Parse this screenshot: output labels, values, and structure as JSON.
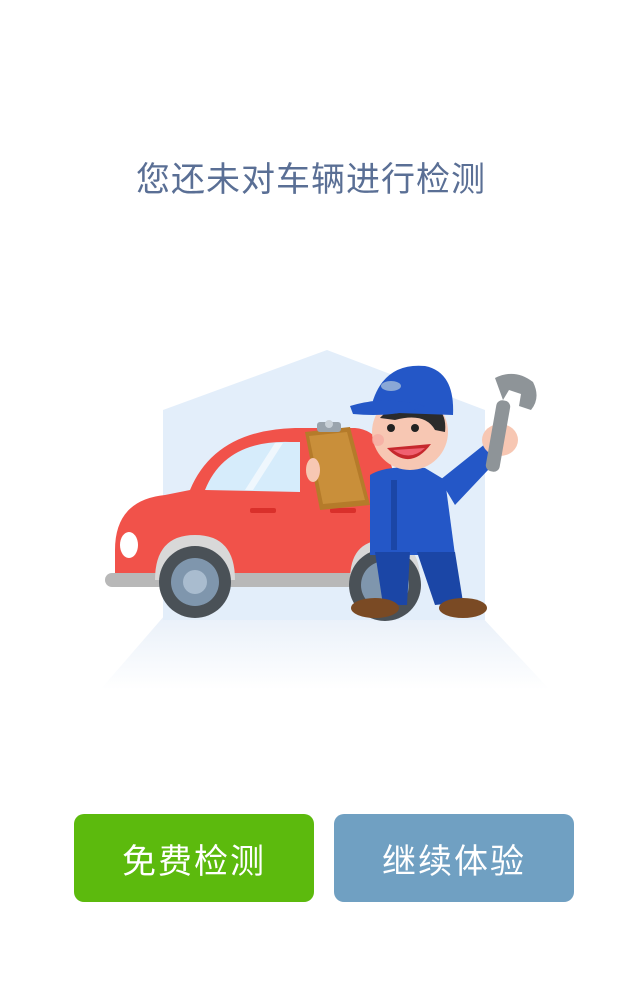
{
  "title": "您还未对车辆进行检测",
  "buttons": {
    "free_check": {
      "label": "免费检测",
      "color": "#5cba0d"
    },
    "continue": {
      "label": "继续体验",
      "color": "#70a0c2"
    }
  },
  "colors": {
    "title": "#5a6f95",
    "car": "#f1524a",
    "mechanic_uniform": "#2457c7",
    "background_house": "#e3eefa"
  }
}
